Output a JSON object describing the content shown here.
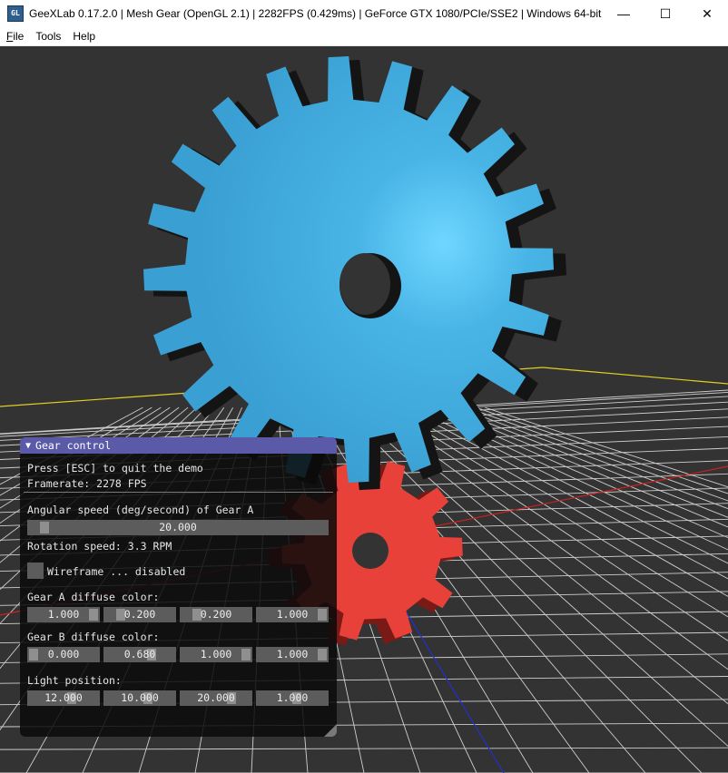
{
  "window": {
    "title": "GeeXLab 0.17.2.0 | Mesh Gear (OpenGL 2.1) | 2282FPS (0.429ms) | GeForce GTX 1080/PCIe/SSE2 | Windows 64-bit",
    "icon_text": "GL",
    "minimize_glyph": "—",
    "maximize_glyph": "☐",
    "close_glyph": "✕"
  },
  "menu": {
    "file_hotkey": "F",
    "file_rest": "ile",
    "tools": "Tools",
    "help": "Help"
  },
  "scene": {
    "background": "#333333",
    "gear_a_color": "#3fa9dc",
    "gear_b_color": "#e8413a",
    "grid_color": "#dcdcdc",
    "axis_x_color": "#cc2020",
    "axis_z_color": "#2030d0",
    "axis_border_color": "#e0d020"
  },
  "panel": {
    "header_arrow": "▼",
    "title": "Gear control",
    "esc_hint": "Press [ESC] to quit the demo",
    "framerate": "Framerate: 2278 FPS",
    "angular_label": "Angular speed (deg/second) of Gear A",
    "angular_value": "20.000",
    "rotation": "Rotation speed: 3.3 RPM",
    "wireframe": "Wireframe ... disabled",
    "gear_a_label": "Gear A diffuse color:",
    "gear_a": [
      "1.000",
      "0.200",
      "0.200",
      "1.000"
    ],
    "gear_b_label": "Gear B diffuse color:",
    "gear_b": [
      "0.000",
      "0.680",
      "1.000",
      "1.000"
    ],
    "light_label": "Light position:",
    "light": [
      "12.000",
      "10.000",
      "20.000",
      "1.000"
    ]
  }
}
